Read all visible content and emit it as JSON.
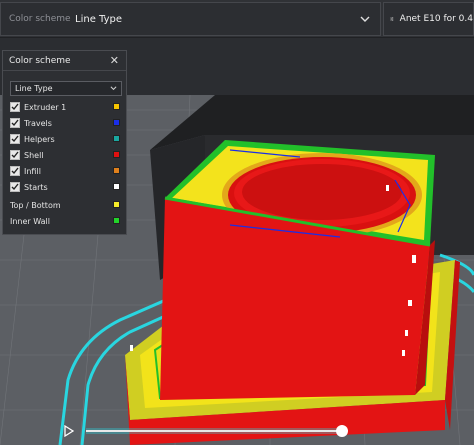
{
  "topbar": {
    "scheme_label": "Color scheme",
    "scheme_value": "Line Type",
    "printer_name": "Anet E10 for 0.4"
  },
  "panel": {
    "title": "Color scheme",
    "select_value": "Line Type",
    "items": [
      {
        "label": "Extruder 1",
        "checked": true,
        "color": "#f5c400"
      },
      {
        "label": "Travels",
        "checked": true,
        "color": "#1a2ee8"
      },
      {
        "label": "Helpers",
        "checked": true,
        "color": "#1aa7a0"
      },
      {
        "label": "Shell",
        "checked": true,
        "color": "#e01010"
      },
      {
        "label": "Infill",
        "checked": true,
        "color": "#e0801c"
      },
      {
        "label": "Starts",
        "checked": true,
        "color": "#ffffff"
      },
      {
        "label": "Top / Bottom",
        "checked": false,
        "color": "#f7ec2a"
      },
      {
        "label": "Inner Wall",
        "checked": false,
        "color": "#22d42a"
      }
    ]
  },
  "slider": {
    "progress": 1.0
  },
  "icons": [
    "chevron-down-icon",
    "settings-sliders-icon",
    "close-icon",
    "checkmark-icon",
    "play-icon"
  ]
}
